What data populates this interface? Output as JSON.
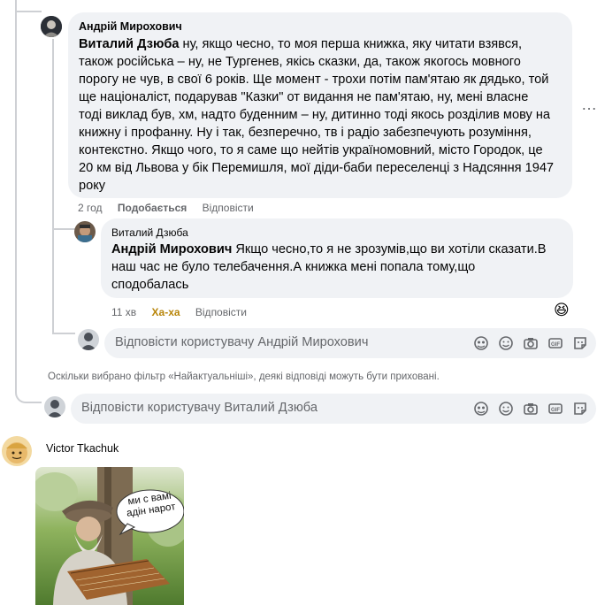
{
  "comment1": {
    "author": "Андрій Мирохович",
    "mention": "Виталий Дзюба",
    "lines": [
      " ну, якщо чесно, то моя перша книжка, яку читати взявся,",
      "також російська – ну, не Тургенев, якісь сказки, да, також якогось мовного",
      "порогу не чув, в свої 6 років. Ще момент - трохи потім пам'ятаю як дядько, той",
      "ще націоналіст, подарував \"Казки\" от видання не пам'ятаю, ну, мені власне",
      "тоді виклад був, хм, надто буденним – ну, дитинно тоді якось розділив мову на",
      "книжну і профанну. Ну і так, безперечно, тв і радіо забезпечують розуміння,",
      "контекстно. Якщо чого, то я саме що нейтів україномовний, місто Городок, це",
      "20 км від Львова у бік Перемишля, мої діди-баби переселенці з Надсяння 1947",
      "року"
    ],
    "time": "2 год",
    "like": "Подобається",
    "reply": "Відповісти"
  },
  "comment2": {
    "author": "Виталий Дзюба",
    "mention": "Андрій Мирохович",
    "lines": [
      " Якщо чесно,то я не зрозумів,що ви хотіли сказати.В",
      "наш час не було телебачення.А книжка мені попала тому,що",
      "сподобалась"
    ],
    "time": "11 хв",
    "reaction": "Ха-ха",
    "reply": "Відповісти",
    "reaction_emoji": "😆"
  },
  "reply_box_1": {
    "placeholder": "Відповісти користувачу Андрій Мирохович"
  },
  "filter_notice": "Оскільки вибрано фільтр «Найактуальніші», деякі відповіді можуть бути приховані.",
  "reply_box_2": {
    "placeholder": "Відповісти користувачу Виталий Дзюба"
  },
  "comment3": {
    "author": "Victor Tkachuk",
    "meme_text": [
      "ми с вамі",
      "адін нарот"
    ]
  },
  "more_icon": "…",
  "icons": [
    "avatar-sticker-icon",
    "emoji-icon",
    "camera-icon",
    "gif-icon",
    "sticker-icon"
  ],
  "colors": {
    "haha": "#b8860b",
    "meta": "#65676b",
    "bubble": "#f0f2f5"
  }
}
